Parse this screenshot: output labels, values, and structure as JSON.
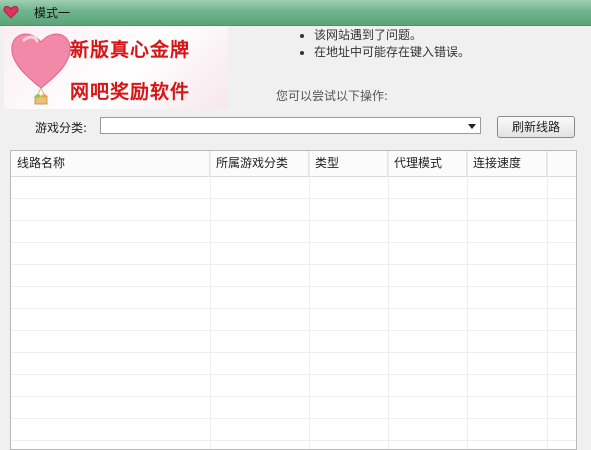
{
  "window": {
    "title": "模式一",
    "icon": "heart-icon"
  },
  "banner": {
    "line1": "新版真心金牌",
    "line2": "网吧奖励软件",
    "icon": "heart-balloon-icon"
  },
  "error_page": {
    "items": [
      "该网站遇到了问题。",
      "在地址中可能存在键入错误。"
    ],
    "try_text": "您可以尝试以下操作:"
  },
  "filter": {
    "label": "游戏分类:",
    "selected": "",
    "refresh_label": "刷新线路"
  },
  "table": {
    "columns": [
      "线路名称",
      "所属游戏分类",
      "类型",
      "代理模式",
      "连接速度"
    ],
    "rows": []
  },
  "colors": {
    "title_bar": "#6fb48c",
    "banner_text": "#d71515",
    "heart": "#f07a9c"
  }
}
